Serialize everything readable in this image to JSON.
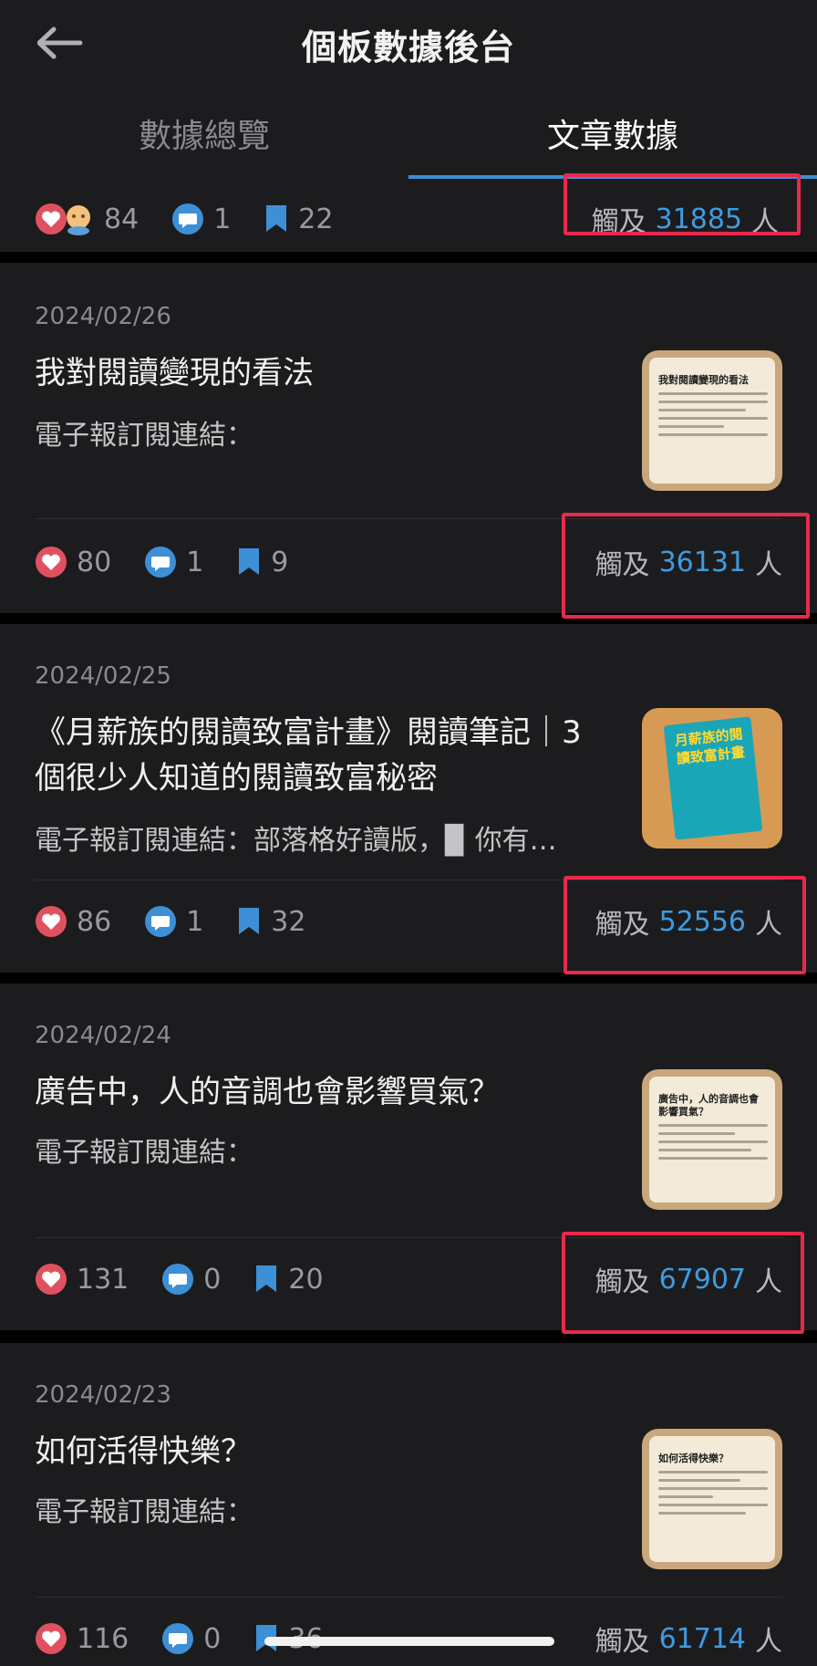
{
  "header": {
    "title": "個板數據後台",
    "back_icon": "arrow-left-icon"
  },
  "tabs": [
    {
      "label": "數據總覽",
      "active": false
    },
    {
      "label": "文章數據",
      "active": true
    }
  ],
  "reach_label": "觸及",
  "reach_unit": "人",
  "top_partial": {
    "likes": "84",
    "comments": "1",
    "saves": "22",
    "reach": "31885"
  },
  "articles": [
    {
      "date": "2024/02/26",
      "title": "我對閱讀變現的看法",
      "excerpt": "電子報訂閱連結：",
      "likes": "80",
      "comments": "1",
      "saves": "9",
      "reach": "36131",
      "thumb_title": "我對閱讀變現的看法"
    },
    {
      "date": "2024/02/25",
      "title": "《月薪族的閱讀致富計畫》閱讀筆記｜3 個很少人知道的閱讀致富秘密",
      "excerpt": "電子報訂閱連結：部落格好讀版，▉ 你有…",
      "likes": "86",
      "comments": "1",
      "saves": "32",
      "reach": "52556",
      "thumb_title": "月薪族的閱讀致富計畫"
    },
    {
      "date": "2024/02/24",
      "title": "廣告中，人的音調也會影響買氣？",
      "excerpt": "電子報訂閱連結：",
      "likes": "131",
      "comments": "0",
      "saves": "20",
      "reach": "67907",
      "thumb_title": "廣告中，人的音調也會影響買氣？"
    },
    {
      "date": "2024/02/23",
      "title": "如何活得快樂？",
      "excerpt": "電子報訂閱連結：",
      "likes": "116",
      "comments": "0",
      "saves": "36",
      "reach": "61714",
      "thumb_title": "如何活得快樂？"
    }
  ],
  "colors": {
    "like": "#e0515f",
    "comment": "#3d8fd6",
    "save": "#3d8fd6",
    "reach_number": "#3f9be0",
    "highlight_box": "#e8294c"
  }
}
